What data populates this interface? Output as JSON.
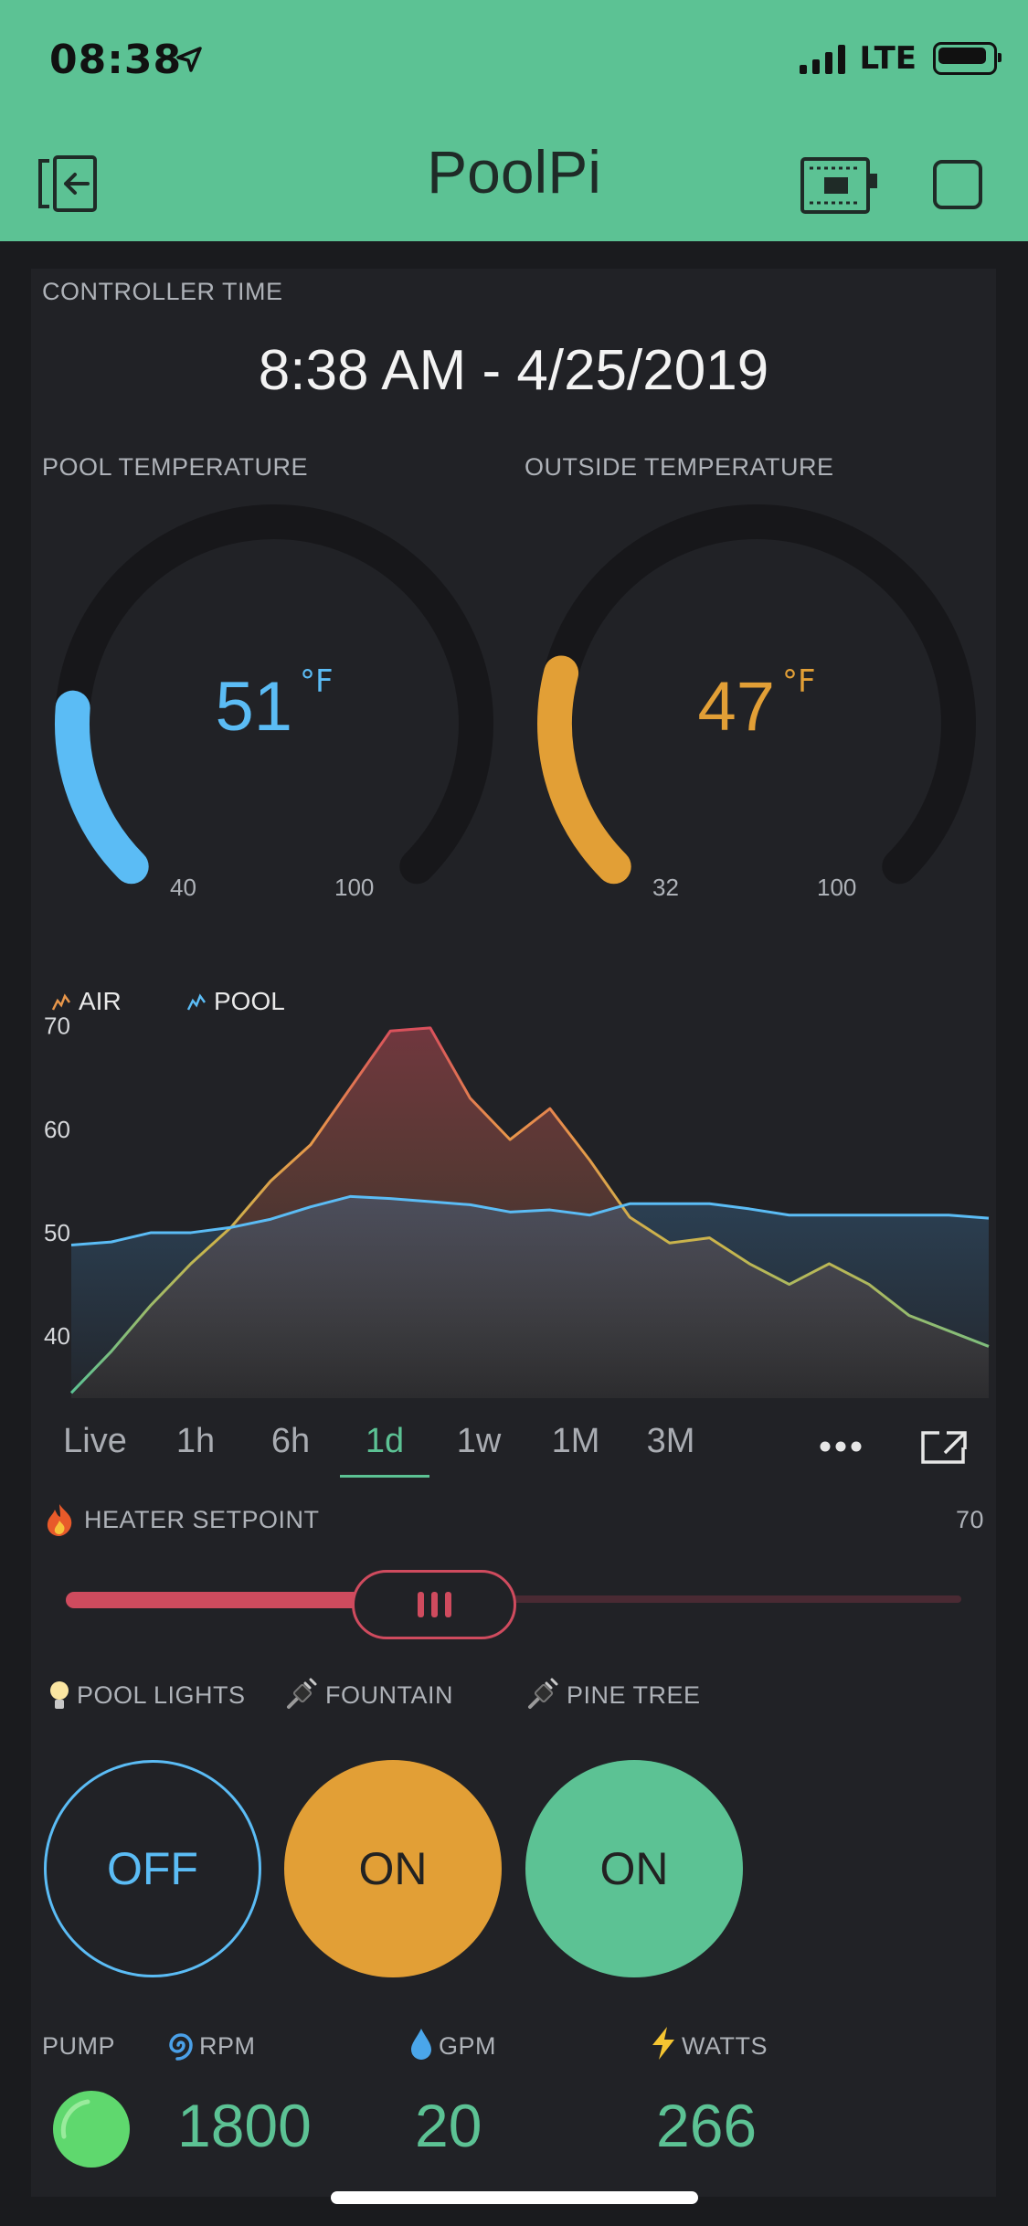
{
  "status": {
    "time": "08:38",
    "network": "LTE"
  },
  "header": {
    "title": "PoolPi"
  },
  "controller": {
    "label": "CONTROLLER TIME",
    "value": "8:38 AM - 4/25/2019"
  },
  "gauges": {
    "pool": {
      "label": "POOL TEMPERATURE",
      "value": "51",
      "unit": "°F",
      "min": "40",
      "max": "100",
      "color": "#5bbcf5"
    },
    "outside": {
      "label": "OUTSIDE TEMPERATURE",
      "value": "47",
      "unit": "°F",
      "min": "32",
      "max": "100",
      "color": "#e29f36"
    }
  },
  "chart_data": {
    "type": "area",
    "legend": [
      "AIR",
      "POOL"
    ],
    "y_ticks": [
      "70",
      "60",
      "50",
      "40"
    ],
    "ylim": [
      34,
      72
    ],
    "series": [
      {
        "name": "AIR",
        "values": [
          34.5,
          38.5,
          43,
          47,
          50.5,
          55,
          58.5,
          64,
          69.5,
          69.8,
          63,
          59,
          62,
          57,
          51.5,
          49,
          49.5,
          47,
          45,
          47,
          45,
          42,
          40.5,
          39
        ],
        "color": "#e8964a"
      },
      {
        "name": "POOL",
        "values": [
          48.8,
          49.1,
          50,
          50,
          50.5,
          51.3,
          52.5,
          53.5,
          53.3,
          53,
          52.7,
          52,
          52.2,
          51.7,
          52.8,
          52.8,
          52.8,
          52.3,
          51.7,
          51.7,
          51.7,
          51.7,
          51.7,
          51.4
        ],
        "color": "#5bbcf5"
      }
    ]
  },
  "range_tabs": [
    "Live",
    "1h",
    "6h",
    "1d",
    "1w",
    "1M",
    "3M"
  ],
  "active_range": "1d",
  "heater": {
    "label": "HEATER SETPOINT",
    "value": "70",
    "fill": 0.33
  },
  "switches": [
    {
      "label": "POOL LIGHTS",
      "state": "OFF"
    },
    {
      "label": "FOUNTAIN",
      "state": "ON"
    },
    {
      "label": "PINE TREE",
      "state": "ON"
    }
  ],
  "pump": {
    "label": "PUMP",
    "rpm_label": "RPM",
    "rpm": "1800",
    "gpm_label": "GPM",
    "gpm": "20",
    "watts_label": "WATTS",
    "watts": "266"
  },
  "colors": {
    "header": "#5cc294",
    "panel": "#212226",
    "accent": "#5cc294",
    "pool": "#5bbcf5",
    "air": "#e29f36",
    "heater": "#cf4b5e"
  }
}
